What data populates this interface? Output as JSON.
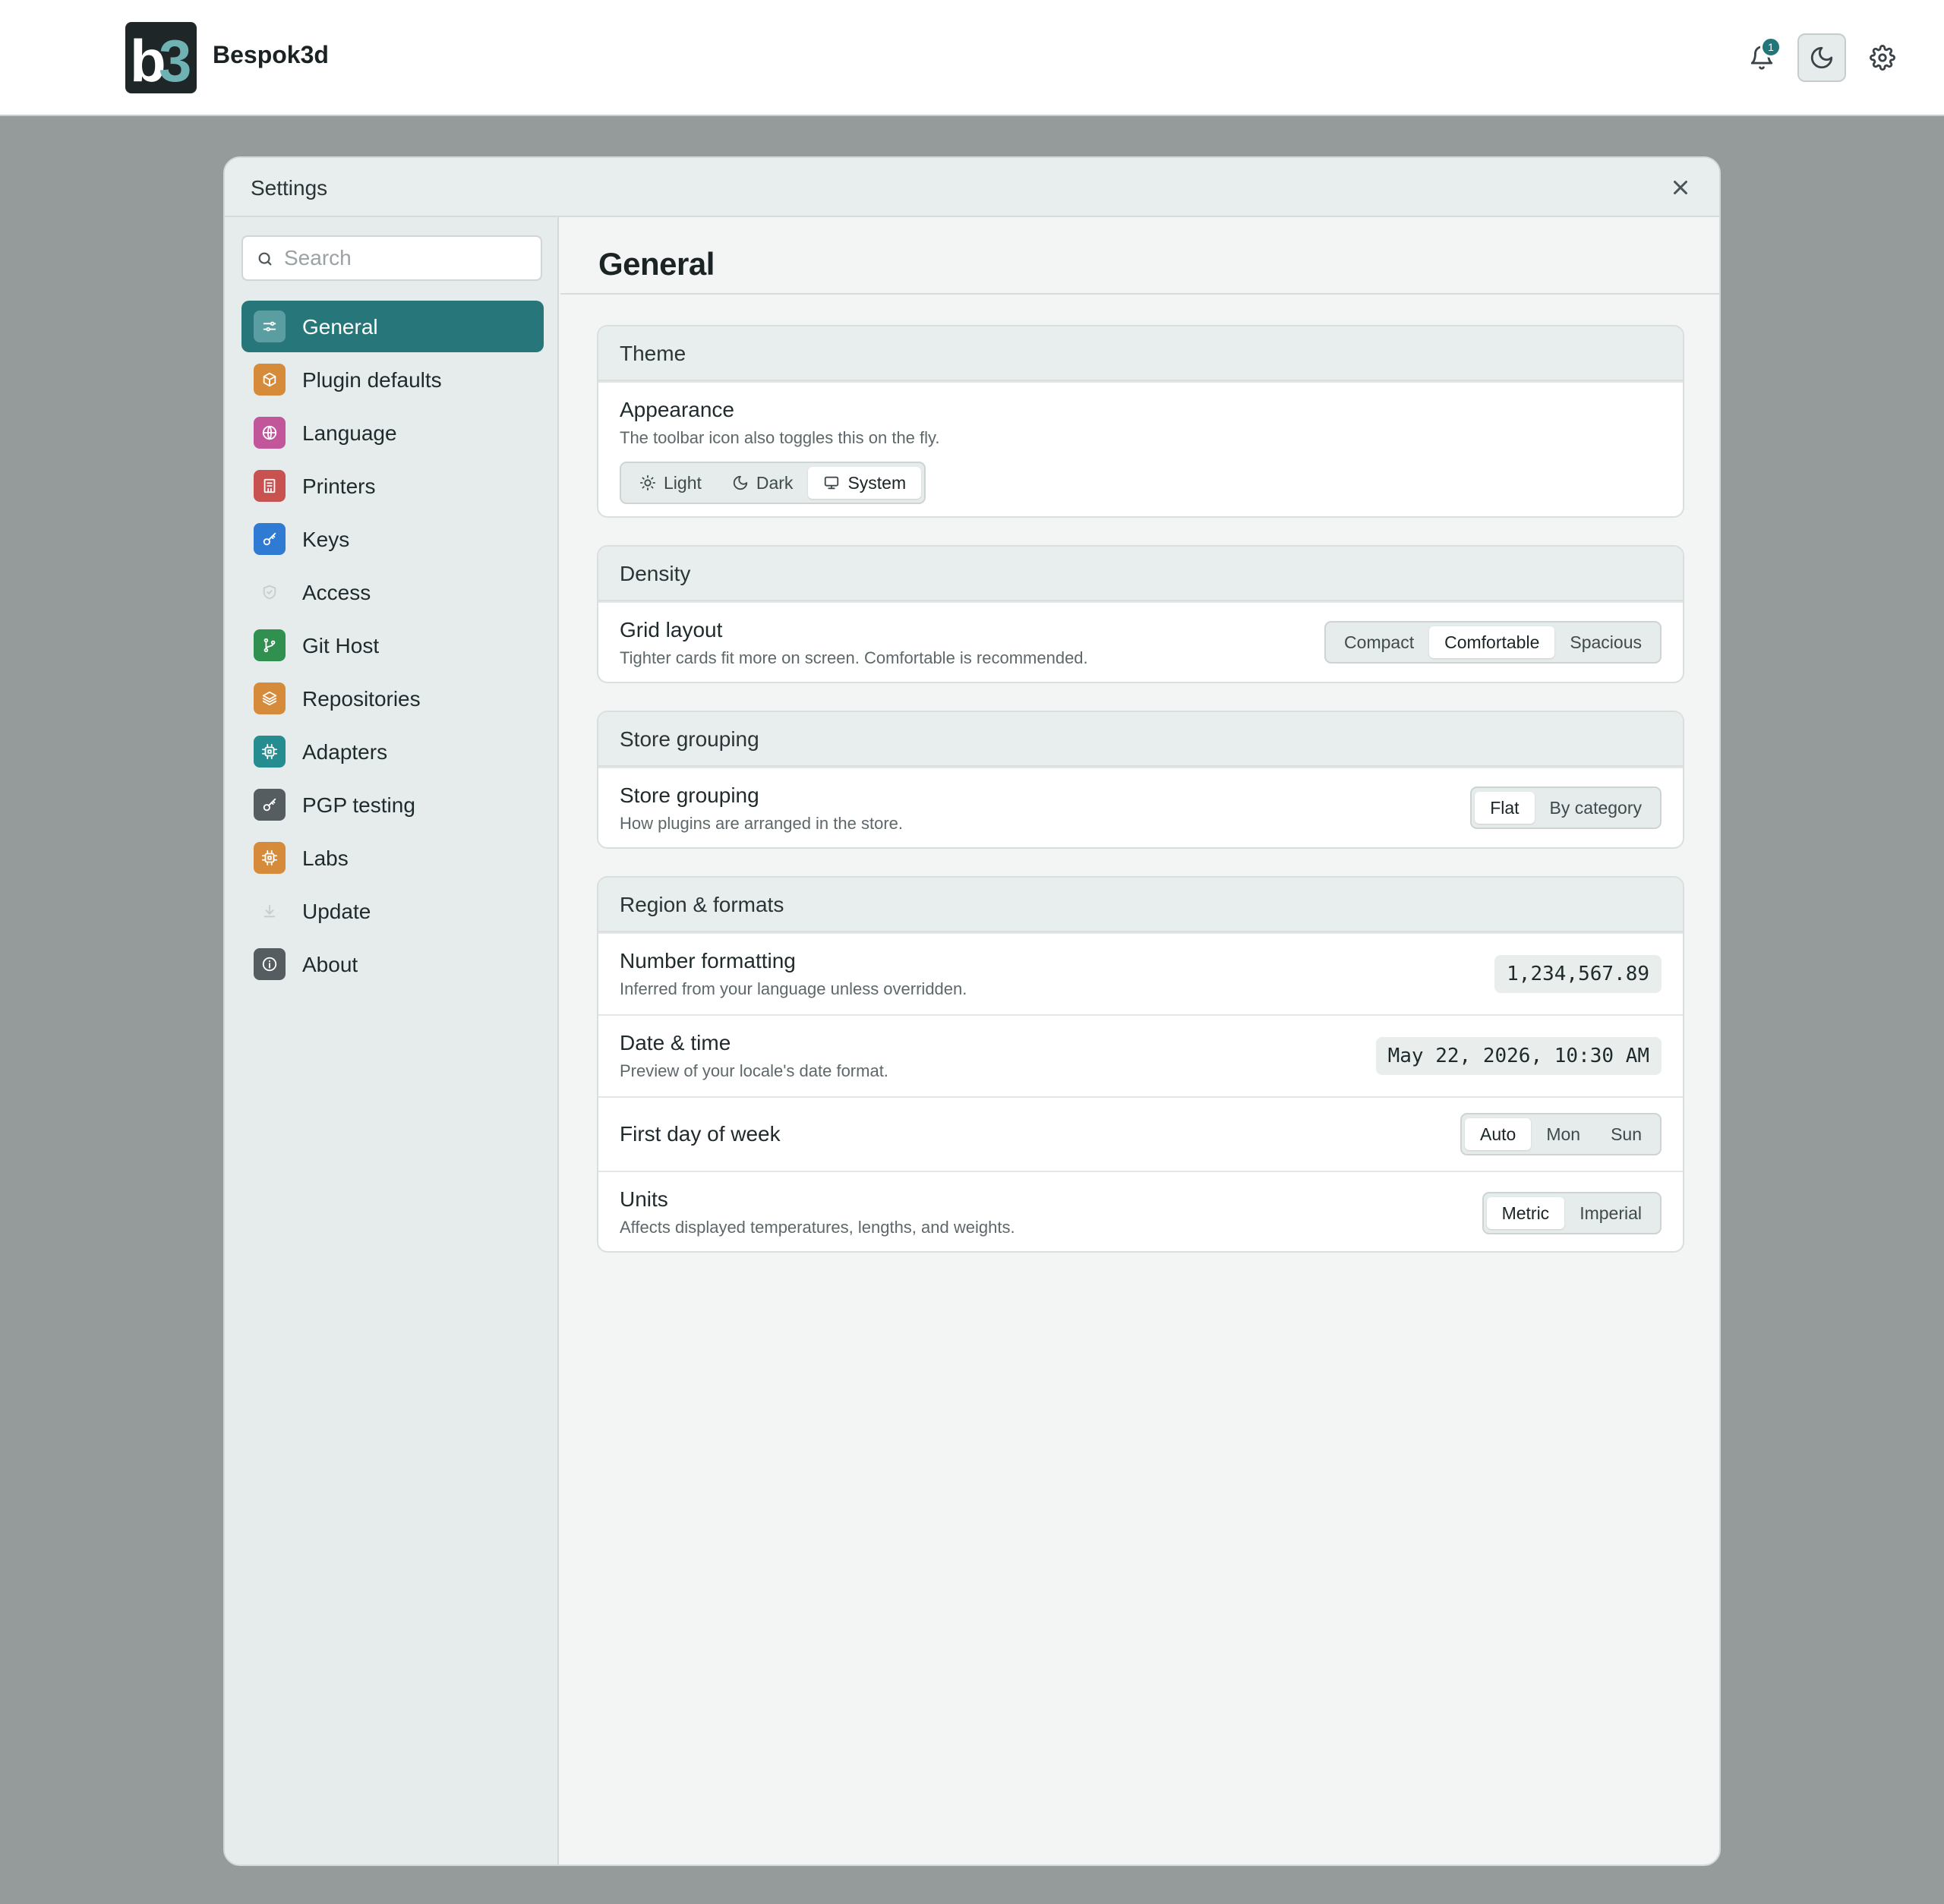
{
  "app": {
    "name": "Bespok3d",
    "logo_text": "b3",
    "notification_count": "1",
    "icons": {
      "notifications": "bell-icon",
      "theme_toggle": "moon-icon",
      "settings": "gear-icon"
    }
  },
  "dialog": {
    "title": "Settings",
    "close_icon": "close-icon",
    "search": {
      "placeholder": "Search",
      "value": ""
    },
    "nav": [
      {
        "label": "General",
        "icon": "sliders-icon",
        "color": "#5a9ea1",
        "active": true
      },
      {
        "label": "Plugin defaults",
        "icon": "cube-icon",
        "color": "#d68b3a"
      },
      {
        "label": "Language",
        "icon": "globe-icon",
        "color": "#c2569b"
      },
      {
        "label": "Printers",
        "icon": "printer-icon",
        "color": "#c8524f"
      },
      {
        "label": "Keys",
        "icon": "key-icon",
        "color": "#2f7bd3"
      },
      {
        "label": "Access",
        "icon": "shield-icon",
        "color": ""
      },
      {
        "label": "Git Host",
        "icon": "git-branch-icon",
        "color": "#2f9050"
      },
      {
        "label": "Repositories",
        "icon": "layers-icon",
        "color": "#d68b3a"
      },
      {
        "label": "Adapters",
        "icon": "chip-icon",
        "color": "#258c8f"
      },
      {
        "label": "PGP testing",
        "icon": "key-icon",
        "color": "#555d61"
      },
      {
        "label": "Labs",
        "icon": "chip-icon",
        "color": "#d68b3a"
      },
      {
        "label": "Update",
        "icon": "download-icon",
        "color": ""
      },
      {
        "label": "About",
        "icon": "info-icon",
        "color": "#555d61"
      }
    ]
  },
  "main": {
    "title": "General",
    "theme": {
      "heading": "Theme",
      "appearance_title": "Appearance",
      "appearance_desc": "The toolbar icon also toggles this on the fly.",
      "options": [
        "Light",
        "Dark",
        "System"
      ],
      "selected": "System"
    },
    "density": {
      "heading": "Density",
      "grid_title": "Grid layout",
      "grid_desc": "Tighter cards fit more on screen. Comfortable is recommended.",
      "options": [
        "Compact",
        "Comfortable",
        "Spacious"
      ],
      "selected": "Comfortable"
    },
    "store": {
      "heading": "Store grouping",
      "title": "Store grouping",
      "desc": "How plugins are arranged in the store.",
      "options": [
        "Flat",
        "By category"
      ],
      "selected": "Flat"
    },
    "region": {
      "heading": "Region & formats",
      "number_title": "Number formatting",
      "number_desc": "Inferred from your language unless overridden.",
      "number_preview": "1,234,567.89",
      "date_title": "Date & time",
      "date_desc": "Preview of your locale's date format.",
      "date_preview": "May 22, 2026, 10:30 AM",
      "week_title": "First day of week",
      "week_options": [
        "Auto",
        "Mon",
        "Sun"
      ],
      "week_selected": "Auto",
      "units_title": "Units",
      "units_desc": "Affects displayed temperatures, lengths, and weights.",
      "units_options": [
        "Metric",
        "Imperial"
      ],
      "units_selected": "Metric"
    }
  },
  "colors": {
    "accent": "#27777a",
    "page_bg": "#959a9a",
    "panel_bg": "#f2f5f4"
  }
}
